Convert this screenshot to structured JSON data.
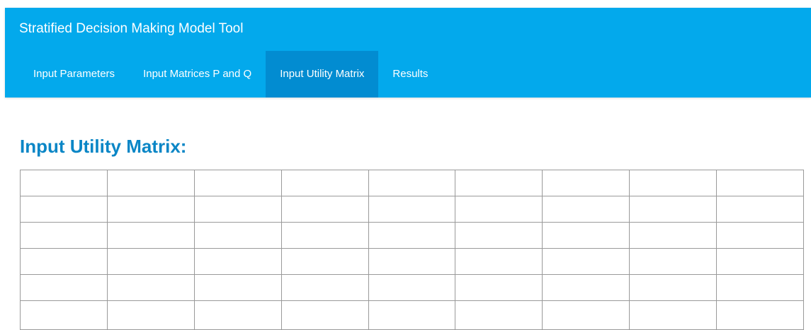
{
  "app": {
    "title": "Stratified Decision Making Model Tool"
  },
  "nav": {
    "tabs": [
      {
        "label": "Input Parameters",
        "active": false
      },
      {
        "label": "Input Matrices P and Q",
        "active": false
      },
      {
        "label": "Input Utility Matrix",
        "active": true
      },
      {
        "label": "Results",
        "active": false
      }
    ]
  },
  "main": {
    "heading": "Input Utility Matrix:",
    "matrix": {
      "rows": [
        [
          "",
          "",
          "",
          "",
          "",
          "",
          "",
          "",
          ""
        ],
        [
          "",
          "",
          "",
          "",
          "",
          "",
          "",
          "",
          ""
        ],
        [
          "",
          "",
          "",
          "",
          "",
          "",
          "",
          "",
          ""
        ],
        [
          "",
          "",
          "",
          "",
          "",
          "",
          "",
          "",
          ""
        ],
        [
          "",
          "",
          "",
          "",
          "",
          "",
          "",
          "",
          ""
        ],
        [
          "",
          "",
          "",
          "",
          "",
          "",
          "",
          "",
          ""
        ]
      ]
    }
  },
  "colors": {
    "navbar": "#03a9ec",
    "active_tab": "#028cd1",
    "heading": "#0a86c6",
    "grid_border": "#9a9a9a"
  }
}
